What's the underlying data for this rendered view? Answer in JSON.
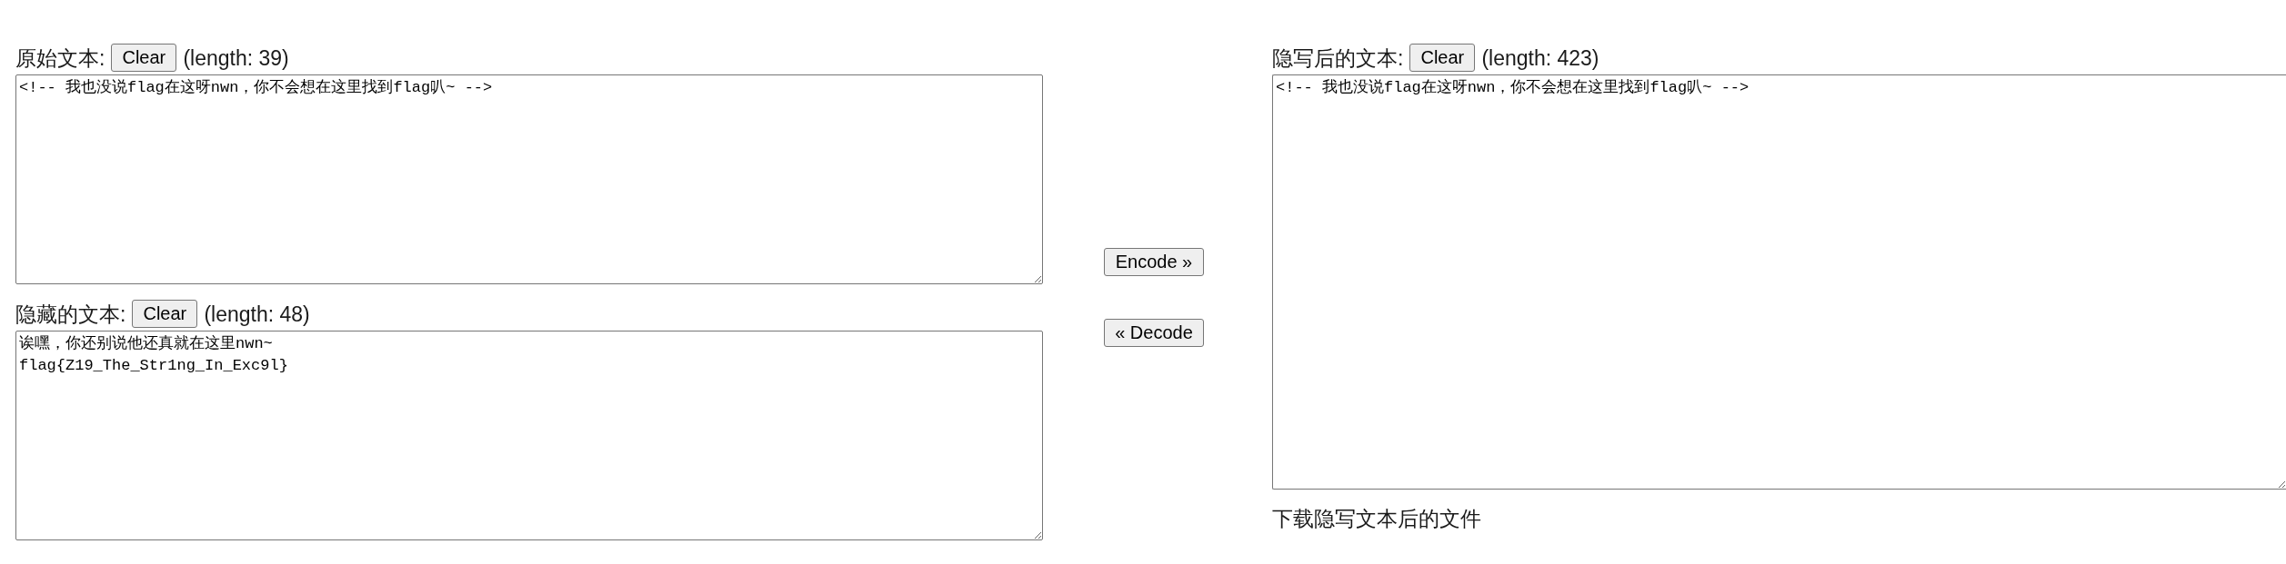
{
  "source_fields": [
    {
      "label": "原始文本:",
      "clear_button": "Clear",
      "length": "(length: 39)",
      "value": "<!-- 我也没说flag在这呀nwn，你不会想在这里找到flag叭~ -->"
    },
    {
      "label": "隐藏的文本:",
      "clear_button": "Clear",
      "length": "(length: 48)",
      "value": "诶嘿，你还别说他还真就在这里nwn~\nflag{Z19_The_Str1ng_In_Exc9l}"
    }
  ],
  "actions": [
    {
      "label": "Encode »"
    },
    {
      "label": "« Decode"
    }
  ],
  "result_field": {
    "label": "隐写后的文本:",
    "clear_button": "Clear",
    "length": "(length: 423)",
    "value": "<!-- 我也没说flag在这呀nwn，你不会想在这里找到flag叭~ -->"
  },
  "download_link": "下载隐写文本后的文件"
}
